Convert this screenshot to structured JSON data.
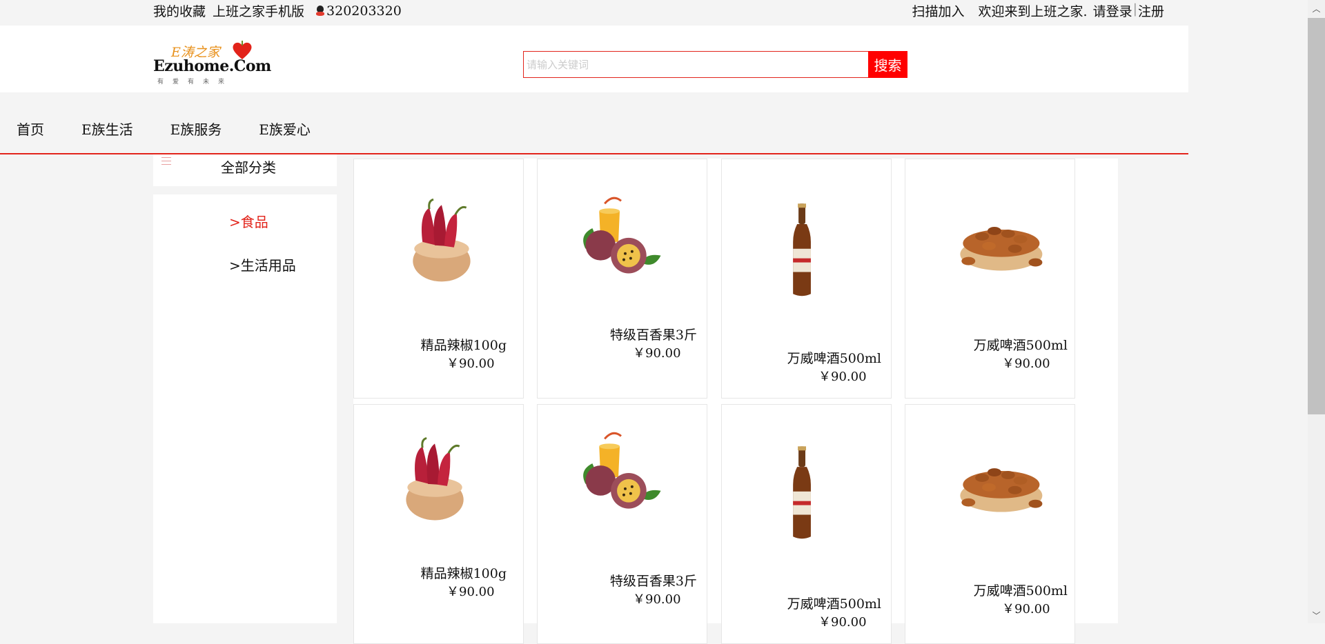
{
  "topbar": {
    "favorites": "我的收藏",
    "mobile": "上班之家手机版",
    "qq_number": "320203320",
    "scan_join": "扫描加入",
    "welcome": "欢迎来到上班之家.",
    "login": "请登录",
    "separator": "|",
    "register": "注册"
  },
  "logo": {
    "e_word": "E涛之家",
    "brand": "Ezuhome.Com",
    "slogan": "有爱有未来"
  },
  "search": {
    "placeholder": "请输入关键词",
    "button_label": "搜索"
  },
  "nav": {
    "items": [
      "首页",
      "E族生活",
      "E族服务",
      "E族爱心"
    ]
  },
  "sidebar": {
    "title": "全部分类",
    "items": [
      {
        "label": ">食品",
        "active": true
      },
      {
        "label": ">生活用品",
        "active": false
      }
    ]
  },
  "products": [
    {
      "name": "精品辣椒100g",
      "price": "￥90.00",
      "icon": "chili-bowl"
    },
    {
      "name": "特级百香果3斤",
      "price": "￥90.00",
      "icon": "passion-fruit"
    },
    {
      "name": "万威啤酒500ml",
      "price": "￥90.00",
      "icon": "beer-bottle"
    },
    {
      "name": "万威啤酒500ml",
      "price": "￥90.00",
      "icon": "nuts-bowl"
    },
    {
      "name": "精品辣椒100g",
      "price": "￥90.00",
      "icon": "chili-bowl"
    },
    {
      "name": "特级百香果3斤",
      "price": "￥90.00",
      "icon": "passion-fruit"
    },
    {
      "name": "万威啤酒500ml",
      "price": "￥90.00",
      "icon": "beer-bottle"
    },
    {
      "name": "万威啤酒500ml",
      "price": "￥90.00",
      "icon": "nuts-bowl"
    }
  ],
  "colors": {
    "accent": "#e2231a",
    "search_button": "#ff0000",
    "background": "#f4f4f4"
  }
}
